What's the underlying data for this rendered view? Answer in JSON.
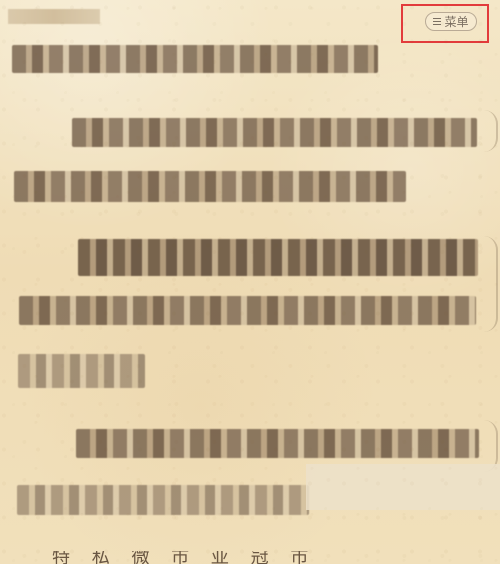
{
  "header": {
    "menu_label": "菜单"
  },
  "icons": {
    "menu": "menu-icon"
  },
  "footer": {
    "partial_text": "特 私 微 市 亚 冠 市 图"
  },
  "colors": {
    "background": "#f1e0bb",
    "text_blur": "#7a624a",
    "menu_border": "#b9aa95",
    "highlight": "#e23b3b"
  }
}
